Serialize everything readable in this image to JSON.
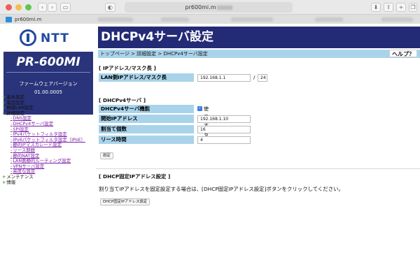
{
  "browser": {
    "url": "pr600mi.m",
    "tab_title": "pr600mi.m"
  },
  "left": {
    "logo_text": "NTT",
    "model": "PR-600MI",
    "fw_label": "ファームウェアバージョン",
    "fw_version": "01.00.0005",
    "nav": [
      {
        "label": "基本設定",
        "level": 1,
        "sign": "+"
      },
      {
        "label": "電話設定",
        "level": 1,
        "sign": "+"
      },
      {
        "label": "無線LAN設定",
        "level": 1,
        "sign": "+"
      },
      {
        "label": "詳細設定",
        "level": 1,
        "sign": "−"
      },
      {
        "label": "DNS設定",
        "level": 2
      },
      {
        "label": "DHCPv4サーバ設定",
        "level": 2
      },
      {
        "label": "SPI設定",
        "level": 2
      },
      {
        "label": "IPv4パケットフィルタ設定",
        "level": 2
      },
      {
        "label": "IPv6パケットフィルタ設定（IPoE）",
        "level": 2
      },
      {
        "label": "静的IPマスカレード設定",
        "level": 2
      },
      {
        "label": "リース期間",
        "level": 2
      },
      {
        "label": "静的NAT設定",
        "level": 2
      },
      {
        "label": "LAN側静的ルーティング設定",
        "level": 2
      },
      {
        "label": "VPNサーバ設定",
        "level": 2
      },
      {
        "label": "高度な設定",
        "level": 2
      },
      {
        "label": "メンテナンス",
        "level": 1,
        "sign": "+"
      },
      {
        "label": "情報",
        "level": 1,
        "sign": "+"
      }
    ]
  },
  "main": {
    "title": "DHCPv4サーバ設定",
    "breadcrumb": "トップページ > 詳細設定 > DHCPv4サーバ設定",
    "help": "ヘルプ？",
    "ip_section": {
      "heading": "[ IPアドレス/マスク長 ]",
      "label": "LAN側IPアドレス/マスク長",
      "ip": "192.168.1.1",
      "slash": "/",
      "mask": "24"
    },
    "dhcp_section": {
      "heading": "[ DHCPv4サーバ ]",
      "func_label": "DHCPv4サーバ機能",
      "func_value": "使用する",
      "start_label": "開始IPアドレス",
      "start_value": "192.168.1.10",
      "count_label": "割当て個数",
      "count_value": "16",
      "lease_label": "リース時間",
      "lease_value": "4",
      "set_button": "設定"
    },
    "fixed_section": {
      "heading": "[ DHCP固定IPアドレス設定 ]",
      "desc": "割り当てIPアドレスを固定設定する場合は、[DHCP固定IPアドレス設定]ボタンをクリックしてください。",
      "button": "DHCP固定IPアドレス設定"
    }
  }
}
